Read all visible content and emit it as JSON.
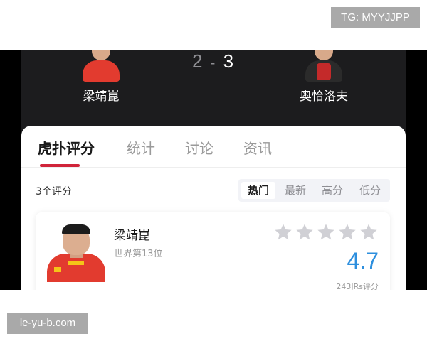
{
  "watermarks": {
    "top": "TG: MYYJJPP",
    "bottom": "le-yu-b.com"
  },
  "match": {
    "score_left": "2",
    "score_sep": "-",
    "score_right": "3",
    "player_left": "梁靖崑",
    "player_right": "奥恰洛夫",
    "player_left_shirt_color": "#e23b2f",
    "player_right_shirt_color": "#2b2b2b"
  },
  "tabs": [
    {
      "label": "虎扑评分",
      "active": true
    },
    {
      "label": "统计",
      "active": false
    },
    {
      "label": "讨论",
      "active": false
    },
    {
      "label": "资讯",
      "active": false
    }
  ],
  "ratings": {
    "count_label": "3个评分",
    "sort_options": [
      {
        "label": "热门",
        "active": true
      },
      {
        "label": "最新",
        "active": false
      },
      {
        "label": "高分",
        "active": false
      },
      {
        "label": "低分",
        "active": false
      }
    ]
  },
  "card": {
    "name": "梁靖崑",
    "rank": "世界第13位",
    "score": "4.7",
    "rating_count": "243JRs评分",
    "stars_total": 5,
    "avatar_icon": "player-photo"
  },
  "colors": {
    "accent_red": "#d0243a",
    "score_blue": "#2d8fde",
    "star_gray": "#d0d0d5",
    "header_bg": "#1c1c1e"
  }
}
